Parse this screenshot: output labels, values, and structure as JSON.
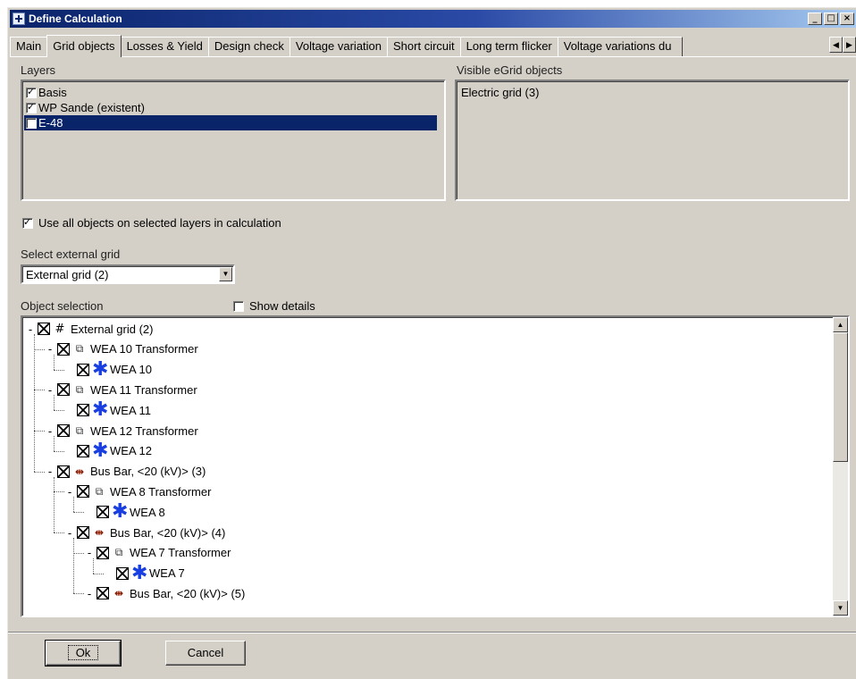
{
  "window": {
    "title": "Define Calculation",
    "controls": {
      "minimize": "_",
      "maximize": "□",
      "close": "×"
    }
  },
  "tabs": [
    {
      "label": "Main"
    },
    {
      "label": "Grid objects",
      "active": true
    },
    {
      "label": "Losses & Yield"
    },
    {
      "label": "Design check"
    },
    {
      "label": "Voltage variation"
    },
    {
      "label": "Short circuit"
    },
    {
      "label": "Long term flicker"
    },
    {
      "label": "Voltage variations du"
    }
  ],
  "tab_scroll": {
    "left": "◀",
    "right": "▶"
  },
  "layers": {
    "label": "Layers",
    "items": [
      {
        "label": "Basis",
        "checked": true
      },
      {
        "label": "WP Sande (existent)",
        "checked": true
      },
      {
        "label": "E-48",
        "checked": false,
        "selected": true
      }
    ]
  },
  "visible_objects": {
    "label": "Visible eGrid objects",
    "items": [
      "Electric grid (3)"
    ]
  },
  "use_all_objects": {
    "label": "Use all objects on selected layers in calculation",
    "checked": true
  },
  "external_grid": {
    "label": "Select external grid",
    "selected": "External grid (2)"
  },
  "object_selection": {
    "label": "Object selection",
    "show_details_label": "Show details",
    "tree": [
      {
        "label": "External grid (2)",
        "icon": "grid-icon",
        "glyph": "#",
        "expander": "-"
      },
      {
        "label": "WEA 10 Transformer",
        "icon": "transformer-icon",
        "glyph": "⧉",
        "expander": "-"
      },
      {
        "label": "WEA 10",
        "icon": "wind-turbine-icon",
        "glyph": "✱",
        "expander": ""
      },
      {
        "label": "WEA 11 Transformer",
        "icon": "transformer-icon",
        "glyph": "⧉",
        "expander": "-"
      },
      {
        "label": "WEA 11",
        "icon": "wind-turbine-icon",
        "glyph": "✱",
        "expander": ""
      },
      {
        "label": "WEA 12 Transformer",
        "icon": "transformer-icon",
        "glyph": "⧉",
        "expander": "-"
      },
      {
        "label": "WEA 12",
        "icon": "wind-turbine-icon",
        "glyph": "✱",
        "expander": ""
      },
      {
        "label": "Bus Bar, <20 (kV)> (3)",
        "icon": "bus-bar-icon",
        "glyph": "⇼",
        "expander": "-"
      },
      {
        "label": "WEA 8 Transformer",
        "icon": "transformer-icon",
        "glyph": "⧉",
        "expander": "-"
      },
      {
        "label": "WEA 8",
        "icon": "wind-turbine-icon",
        "glyph": "✱",
        "expander": ""
      },
      {
        "label": "Bus Bar, <20 (kV)> (4)",
        "icon": "bus-bar-icon",
        "glyph": "⇼",
        "expander": "-"
      },
      {
        "label": "WEA 7 Transformer",
        "icon": "transformer-icon",
        "glyph": "⧉",
        "expander": "-"
      },
      {
        "label": "WEA 7",
        "icon": "wind-turbine-icon",
        "glyph": "✱",
        "expander": ""
      },
      {
        "label": "Bus Bar, <20 (kV)> (5)",
        "icon": "bus-bar-icon",
        "glyph": "⇼",
        "expander": "-"
      }
    ]
  },
  "buttons": {
    "ok": "Ok",
    "cancel": "Cancel"
  }
}
